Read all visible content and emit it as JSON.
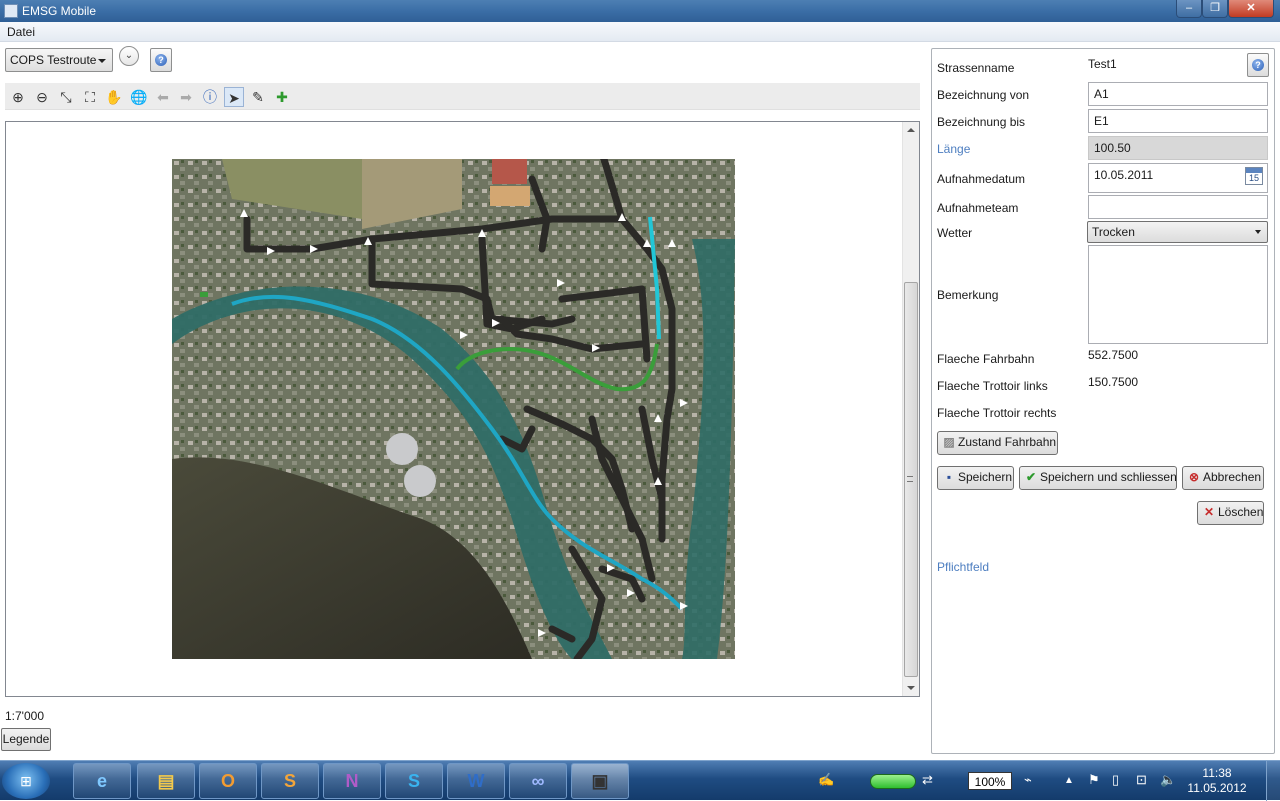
{
  "window": {
    "title": "EMSG Mobile"
  },
  "menu": {
    "items": [
      "Datei"
    ]
  },
  "route": {
    "selected": "COPS Testroute"
  },
  "map": {
    "scale": "1:7'000",
    "legend_label": "Legende"
  },
  "form": {
    "strassenname": {
      "label": "Strassenname",
      "value": "Test1"
    },
    "bez_von": {
      "label": "Bezeichnung von",
      "value": "A1"
    },
    "bez_bis": {
      "label": "Bezeichnung bis",
      "value": "E1"
    },
    "laenge": {
      "label": "Länge",
      "value": "100.50"
    },
    "aufnahmedatum": {
      "label": "Aufnahmedatum",
      "value": "10.05.2011",
      "calendar_day": "15"
    },
    "aufnahmeteam": {
      "label": "Aufnahmeteam",
      "value": ""
    },
    "wetter": {
      "label": "Wetter",
      "value": "Trocken"
    },
    "bemerkung": {
      "label": "Bemerkung",
      "value": ""
    },
    "flaeche_fahrbahn": {
      "label": "Flaeche Fahrbahn",
      "value": "552.7500"
    },
    "flaeche_trottoir_links": {
      "label": "Flaeche Trottoir links",
      "value": "150.7500"
    },
    "flaeche_trottoir_rechts": {
      "label": "Flaeche Trottoir rechts",
      "value": ""
    },
    "zustand_button": "Zustand Fahrbahn",
    "save": "Speichern",
    "save_close": "Speichern und schliessen",
    "cancel": "Abbrechen",
    "delete": "Löschen",
    "pflichtfeld": "Pflichtfeld"
  },
  "taskbar": {
    "battery": "100%",
    "time": "11:38",
    "date": "11.05.2012"
  }
}
